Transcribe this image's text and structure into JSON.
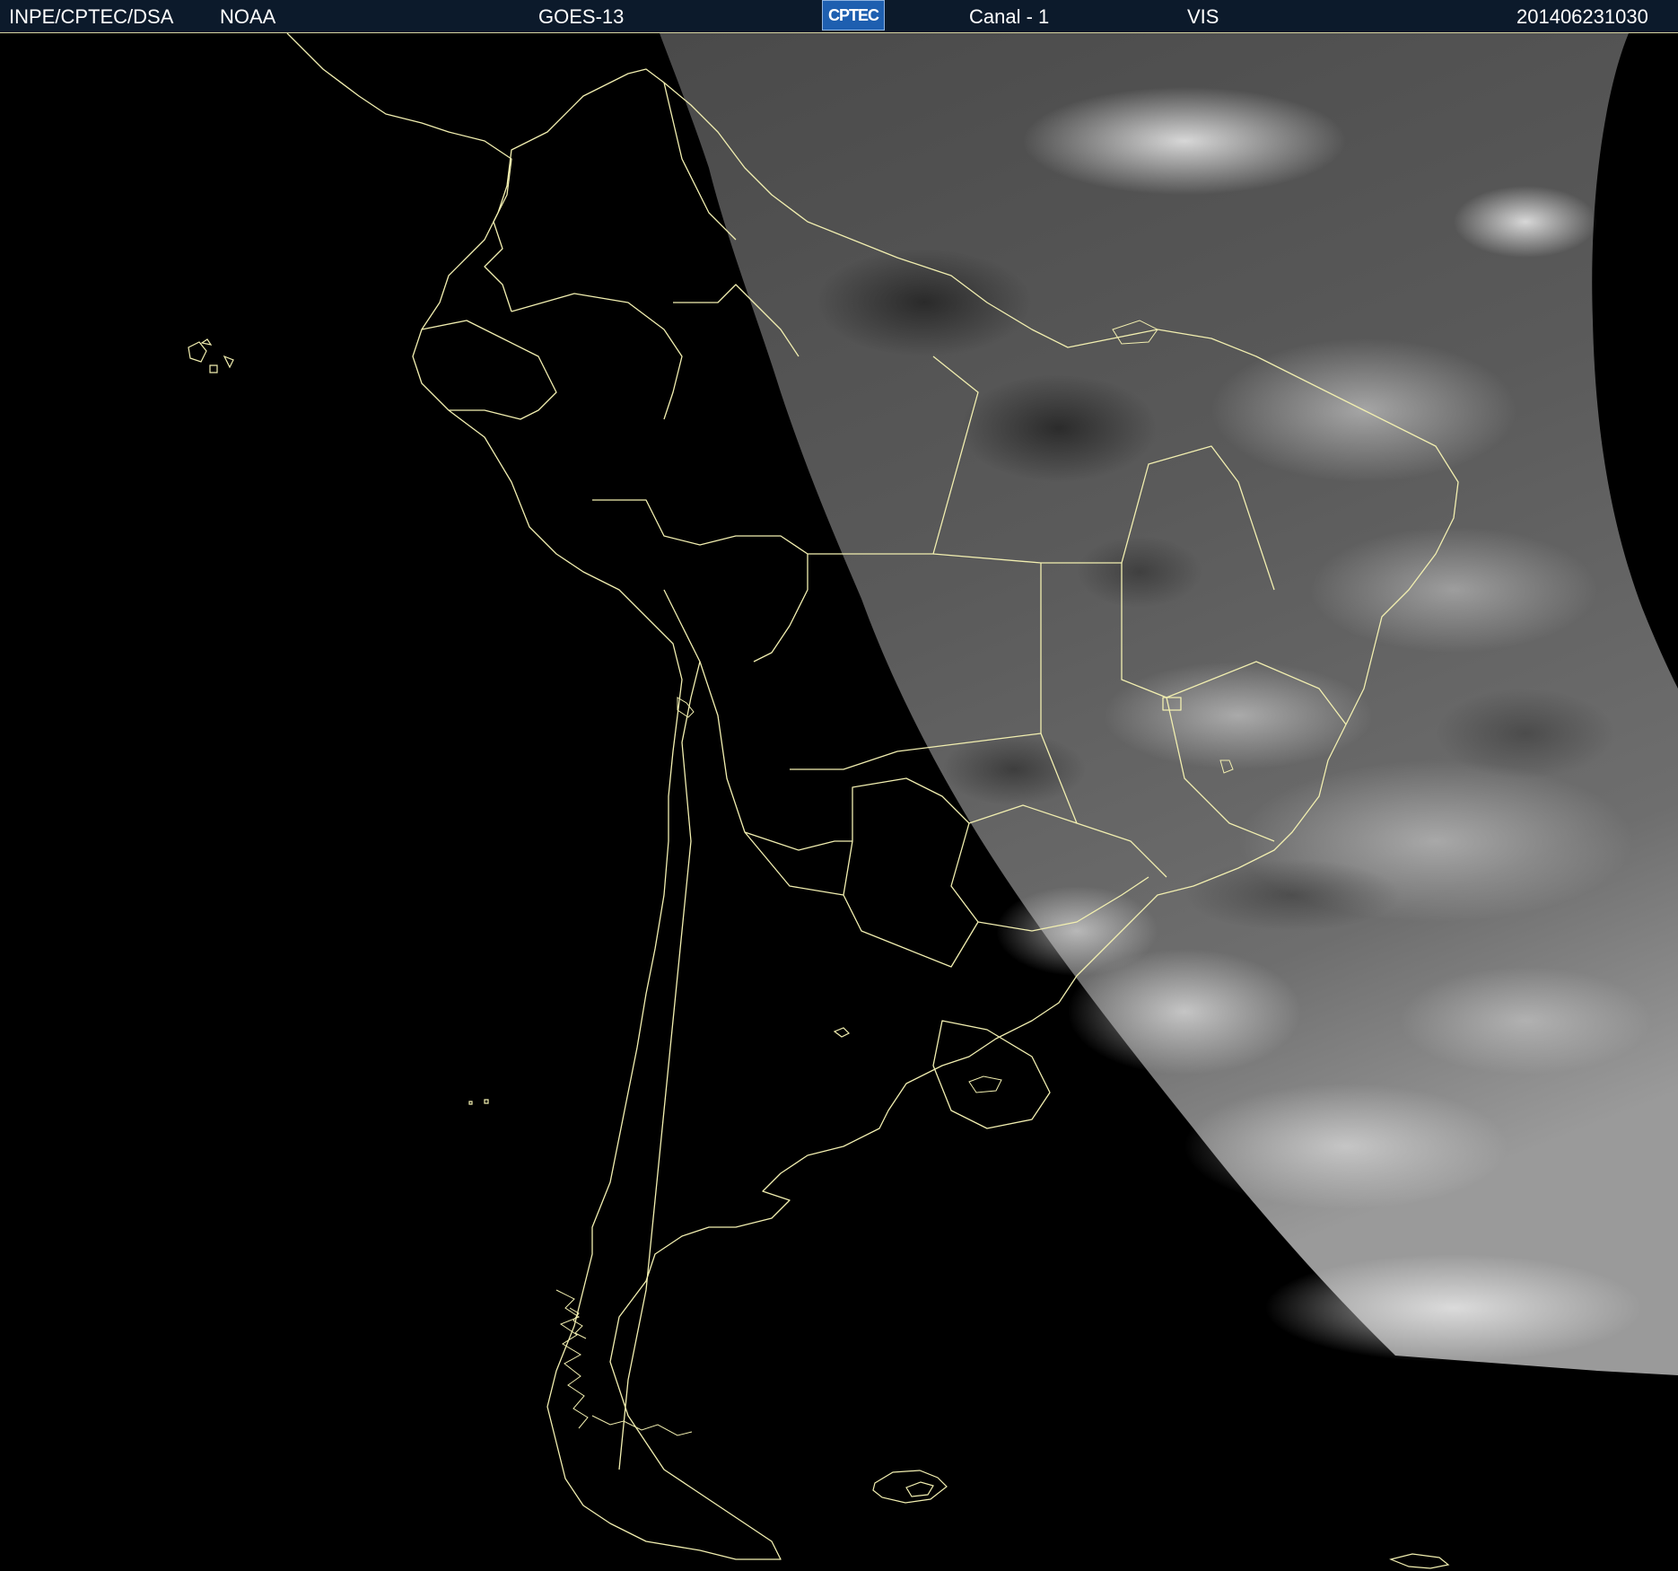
{
  "header": {
    "agency": "INPE/CPTEC/DSA",
    "partner": "NOAA",
    "satellite": "GOES-13",
    "logo_text": "CPTEC",
    "channel": "Canal - 1",
    "band": "VIS",
    "timestamp": "201406231030"
  },
  "colors": {
    "header_bg": "#0c1a2b",
    "border_lines": "#f2efb0",
    "space": "#000000",
    "cloud_dark": "#3a3a3a",
    "cloud_bright": "#d8d8d8"
  },
  "map": {
    "projection": "satellite-view",
    "region": "South America",
    "imagery": "visible channel, partially illuminated disk (east side lit)"
  }
}
